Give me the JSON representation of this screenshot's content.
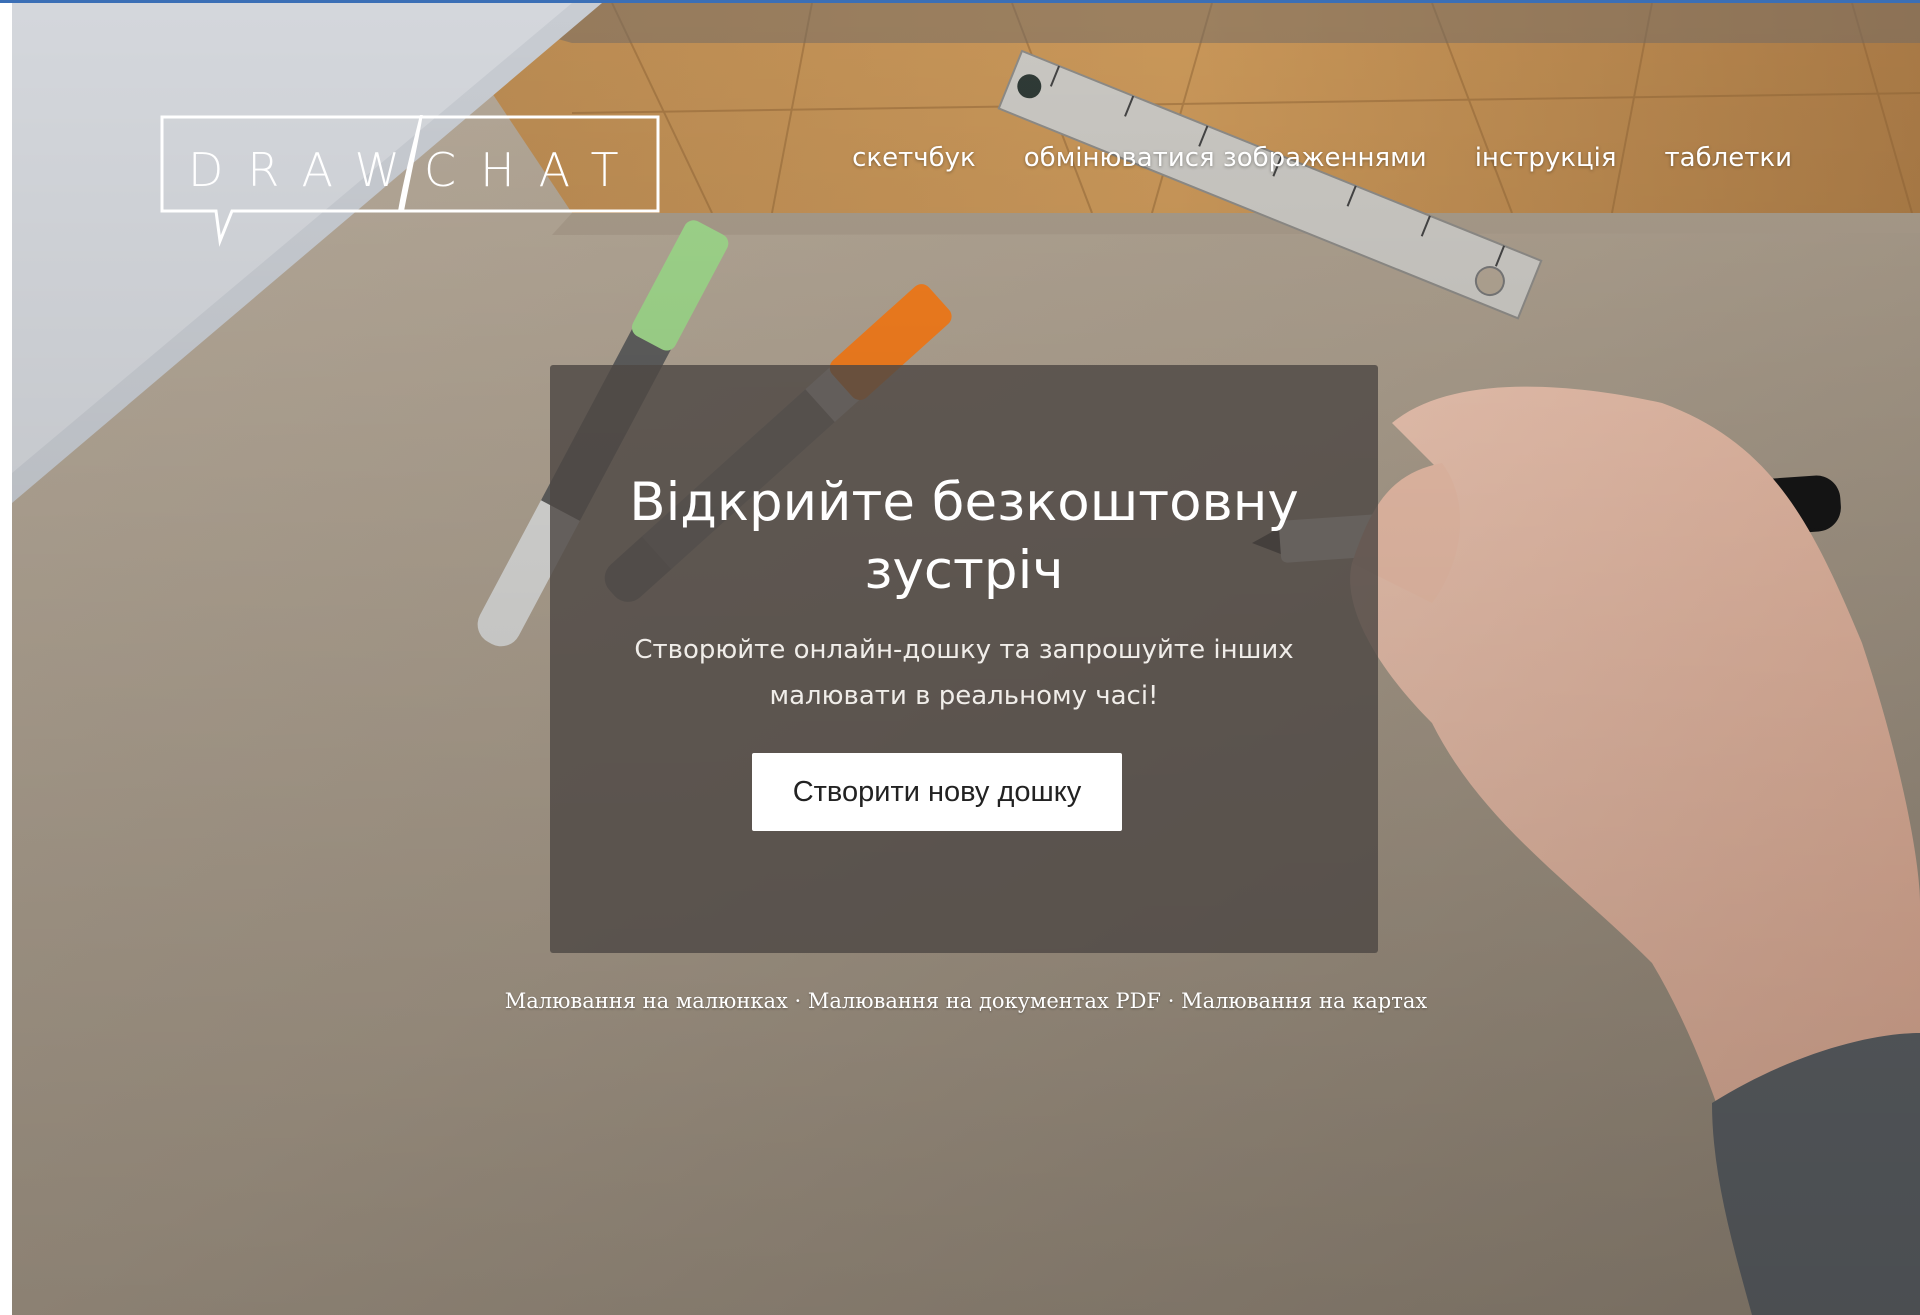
{
  "logo": {
    "text": "DRAWCHAT"
  },
  "nav": {
    "items": [
      {
        "label": "скетчбук"
      },
      {
        "label": "обмінюватися зображеннями"
      },
      {
        "label": "інструкція"
      },
      {
        "label": "таблетки"
      }
    ]
  },
  "hero": {
    "title": "Відкрийте безкоштовну зустріч",
    "subtitle": "Створюйте онлайн-дошку та запрошуйте інших малювати в реальному часі!",
    "cta_label": "Створити нову дошку"
  },
  "links": {
    "items": [
      {
        "label": "Малювання на малюнках"
      },
      {
        "label": "Малювання на документах PDF"
      },
      {
        "label": "Малювання на картах"
      }
    ],
    "separator": "·"
  },
  "colors": {
    "accent_top_bar": "#3b6fb6",
    "card_background": "#4e4844",
    "button_background": "#ffffff"
  }
}
